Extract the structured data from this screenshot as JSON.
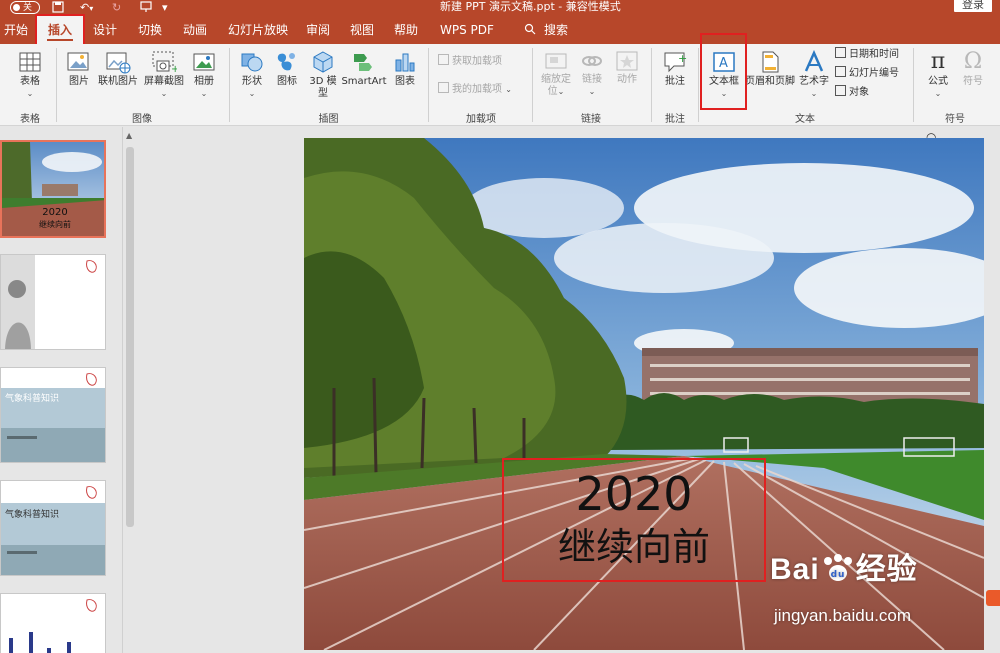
{
  "titlebar": {
    "autosave_label": "关",
    "document_title": "新建 PPT 演示文稿.ppt - 兼容性模式",
    "login_label": "登录"
  },
  "tabs": [
    {
      "label": "开始"
    },
    {
      "label": "插入",
      "active": true
    },
    {
      "label": "设计"
    },
    {
      "label": "切换"
    },
    {
      "label": "动画"
    },
    {
      "label": "幻灯片放映"
    },
    {
      "label": "审阅"
    },
    {
      "label": "视图"
    },
    {
      "label": "帮助"
    },
    {
      "label": "WPS PDF"
    }
  ],
  "search": {
    "label": "搜索",
    "icon": "lightbulb-icon"
  },
  "ribbon": {
    "groups": {
      "tables": "表格",
      "images": "图像",
      "illustrations": "插图",
      "addins": "加载项",
      "links": "链接",
      "comments": "批注",
      "text": "文本",
      "symbols": "符号"
    },
    "buttons": {
      "table": "表格",
      "picture": "图片",
      "online_picture": "联机图片",
      "screenshot": "屏幕截图",
      "album": "相册",
      "shapes": "形状",
      "icons": "图标",
      "model_3d": "3D 模型",
      "smartart": "SmartArt",
      "chart": "图表",
      "get_addins": "获取加载项",
      "my_addins": "我的加载项",
      "zoom": "缩放定位",
      "link": "链接",
      "action": "动作",
      "comment": "批注",
      "textbox": "文本框",
      "header_footer": "页眉和页脚",
      "wordart": "艺术字",
      "date_time": "日期和时间",
      "slide_number": "幻灯片编号",
      "object": "对象",
      "equation": "公式",
      "symbol": "符号"
    }
  },
  "thumbnails": [
    {
      "index": 1,
      "year": "2020",
      "subtitle": "继续向前",
      "selected": true
    },
    {
      "index": 2
    },
    {
      "index": 3,
      "caption": "气象科普知识"
    },
    {
      "index": 4,
      "caption": "气象科普知识"
    },
    {
      "index": 5
    }
  ],
  "slide": {
    "year": "2020",
    "subtitle": "继续向前"
  },
  "watermark": {
    "logo": "Bai",
    "logo_suffix": "经验",
    "url": "jingyan.baidu.com"
  },
  "colors": {
    "accent": "#b7472a",
    "highlight": "#e02020"
  }
}
